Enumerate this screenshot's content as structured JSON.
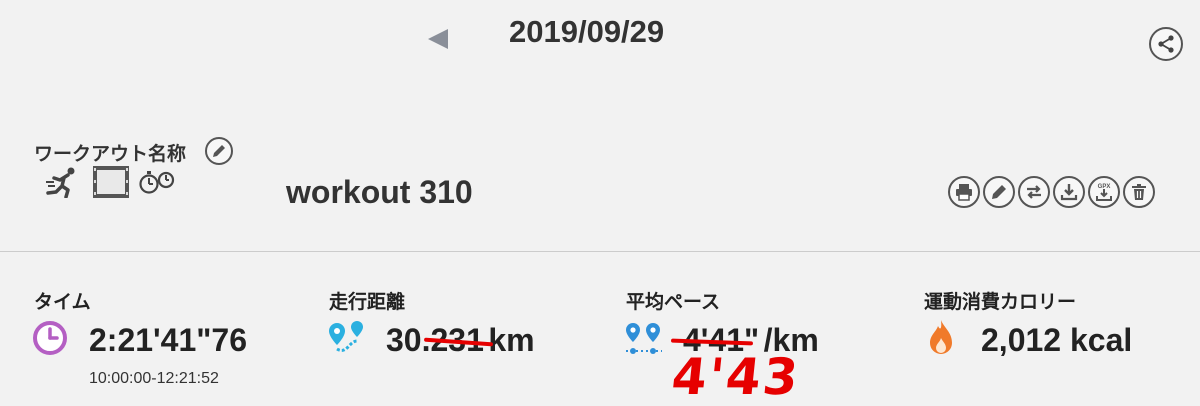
{
  "header": {
    "date": "2019/09/29",
    "prev_icon": "triangle-left-icon",
    "share_icon": "share-icon"
  },
  "workout": {
    "name_label": "ワークアウト名称",
    "name": "workout 310",
    "type_icons": [
      "runner-icon",
      "film-icon",
      "stopwatch-icon"
    ],
    "toolbar_icons": [
      "printer-icon",
      "pencil-icon",
      "swap-icon",
      "download-icon",
      "gpx-download-icon",
      "trash-icon"
    ],
    "gpx_badge": "GPX"
  },
  "stats": {
    "time": {
      "label": "タイム",
      "value": "2:21'41\"76",
      "range": "10:00:00-12:21:52",
      "icon": "clock-icon",
      "icon_color": "#b45fc3"
    },
    "distance": {
      "label": "走行距離",
      "value_int": "30.",
      "value_struck": "231",
      "unit": "km",
      "icon": "map-pin-icon",
      "icon_color": "#2bb0e0"
    },
    "pace": {
      "label": "平均ペース",
      "value_struck": "4'41\"",
      "unit": "/km",
      "handwritten": "4'43",
      "icon": "pace-pins-icon",
      "icon_color": "#2f8fd8"
    },
    "calories": {
      "label": "運動消費カロリー",
      "value": "2,012 kcal",
      "icon": "flame-icon",
      "icon_color": "#f07a2a"
    }
  },
  "colors": {
    "annotation": "#e60000",
    "background": "#f2f2f2"
  }
}
